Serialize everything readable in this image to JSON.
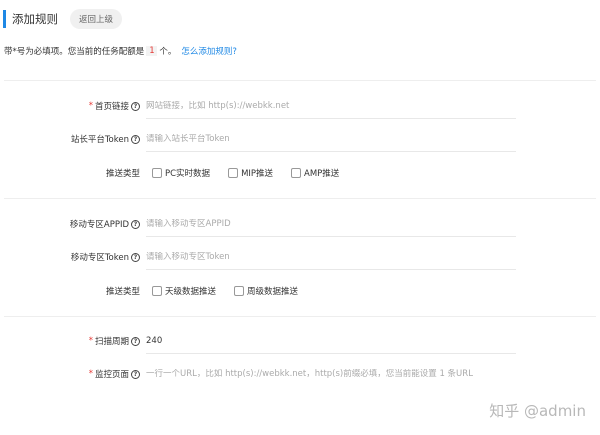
{
  "header": {
    "title": "添加规则",
    "back_label": "返回上级"
  },
  "quota": {
    "prefix": "带*号为必填项。您当前的任务配额是",
    "count": "1",
    "suffix": "个。",
    "help_link": "怎么添加规则?"
  },
  "help_icon_glyph": "?",
  "required_mark": "*",
  "section1": {
    "homepage": {
      "label": "首页链接",
      "placeholder": "网站链接，比如 http(s)://webkk.net"
    },
    "token": {
      "label": "站长平台Token",
      "placeholder": "请输入站长平台Token"
    },
    "push_type": {
      "label": "推送类型",
      "options": [
        "PC实时数据",
        "MIP推送",
        "AMP推送"
      ]
    }
  },
  "section2": {
    "appid": {
      "label": "移动专区APPID",
      "placeholder": "请输入移动专区APPID"
    },
    "token": {
      "label": "移动专区Token",
      "placeholder": "请输入移动专区Token"
    },
    "push_type": {
      "label": "推送类型",
      "options": [
        "天级数据推送",
        "周级数据推送"
      ]
    }
  },
  "section3": {
    "scan_period": {
      "label": "扫描周期",
      "value": "240"
    },
    "monitor_page": {
      "label": "监控页面",
      "placeholder": "一行一个URL，比如 http(s)://webkk.net，http(s)前缀必填，您当前能设置 1 条URL"
    }
  },
  "watermark": "知乎 @admin",
  "colors": {
    "accent": "#1e88e5",
    "required": "#e53935",
    "placeholder": "#aaaaaa"
  }
}
